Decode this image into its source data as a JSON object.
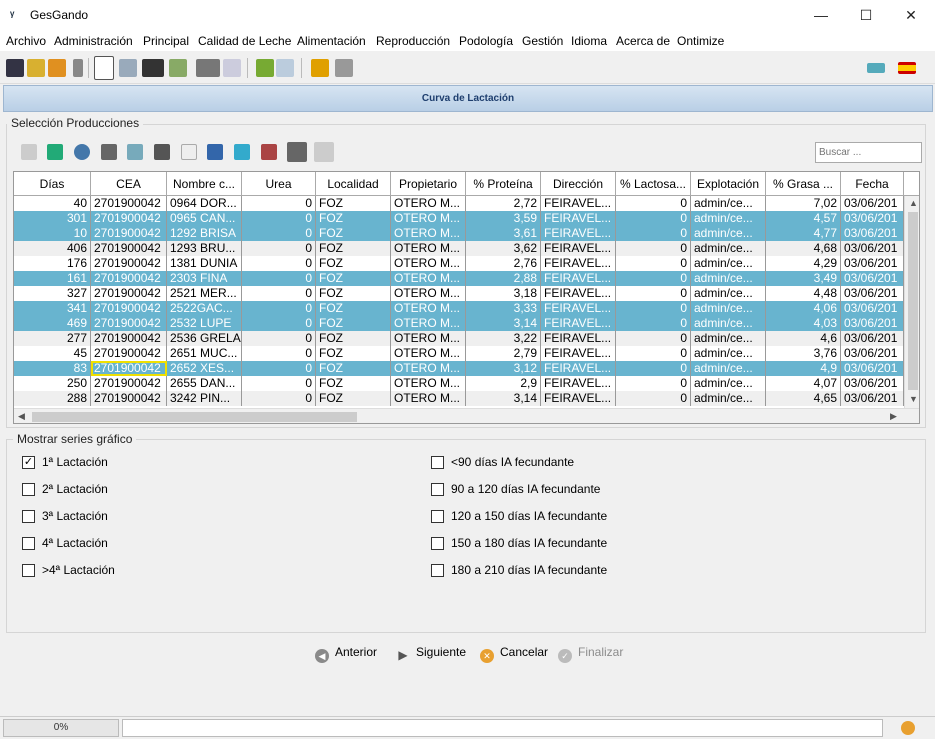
{
  "window": {
    "title": "GesGando",
    "app_icon": "cow-horns-icon",
    "min": "—",
    "max": "☐",
    "close": "✕"
  },
  "menu": [
    "Archivo",
    "Administración",
    "Principal",
    "Calidad de Leche",
    "Alimentación",
    "Reproducción",
    "Podología",
    "Gestión",
    "Idioma",
    "Acerca de",
    "Ontimize"
  ],
  "panel": {
    "title": "Curva de Lactación"
  },
  "selection_group": {
    "label": "Selección Producciones",
    "search_placeholder": "Buscar ..."
  },
  "table": {
    "columns": [
      "Días",
      "CEA",
      "Nombre c...",
      "Urea",
      "Localidad",
      "Propietario",
      "% Proteína",
      "Dirección",
      "% Lactosa...",
      "Explotación",
      "% Grasa ...",
      "Fecha"
    ],
    "rows": [
      {
        "selected": false,
        "cells": [
          "40",
          "2701900042",
          "0964 DOR...",
          "0",
          "FOZ",
          "OTERO M...",
          "2,72",
          "FEIRAVEL...",
          "0",
          "admin/ce...",
          "7,02",
          "03/06/201"
        ]
      },
      {
        "selected": true,
        "cells": [
          "301",
          "2701900042",
          "0965 CAN...",
          "0",
          "FOZ",
          "OTERO M...",
          "3,59",
          "FEIRAVEL...",
          "0",
          "admin/ce...",
          "4,57",
          "03/06/201"
        ]
      },
      {
        "selected": true,
        "cells": [
          "10",
          "2701900042",
          "1292 BRISA",
          "0",
          "FOZ",
          "OTERO M...",
          "3,61",
          "FEIRAVEL...",
          "0",
          "admin/ce...",
          "4,77",
          "03/06/201"
        ]
      },
      {
        "selected": false,
        "cells": [
          "406",
          "2701900042",
          "1293 BRU...",
          "0",
          "FOZ",
          "OTERO M...",
          "3,62",
          "FEIRAVEL...",
          "0",
          "admin/ce...",
          "4,68",
          "03/06/201"
        ]
      },
      {
        "selected": false,
        "cells": [
          "176",
          "2701900042",
          "1381 DUNIA",
          "0",
          "FOZ",
          "OTERO M...",
          "2,76",
          "FEIRAVEL...",
          "0",
          "admin/ce...",
          "4,29",
          "03/06/201"
        ]
      },
      {
        "selected": true,
        "cells": [
          "161",
          "2701900042",
          "2303 FINA",
          "0",
          "FOZ",
          "OTERO M...",
          "2,88",
          "FEIRAVEL...",
          "0",
          "admin/ce...",
          "3,49",
          "03/06/201"
        ]
      },
      {
        "selected": false,
        "cells": [
          "327",
          "2701900042",
          "2521 MER...",
          "0",
          "FOZ",
          "OTERO M...",
          "3,18",
          "FEIRAVEL...",
          "0",
          "admin/ce...",
          "4,48",
          "03/06/201"
        ]
      },
      {
        "selected": true,
        "cells": [
          "341",
          "2701900042",
          "2522GAC...",
          "0",
          "FOZ",
          "OTERO M...",
          "3,33",
          "FEIRAVEL...",
          "0",
          "admin/ce...",
          "4,06",
          "03/06/201"
        ]
      },
      {
        "selected": true,
        "cells": [
          "469",
          "2701900042",
          "2532 LUPE",
          "0",
          "FOZ",
          "OTERO M...",
          "3,14",
          "FEIRAVEL...",
          "0",
          "admin/ce...",
          "4,03",
          "03/06/201"
        ]
      },
      {
        "selected": false,
        "cells": [
          "277",
          "2701900042",
          "2536 GRELA",
          "0",
          "FOZ",
          "OTERO M...",
          "3,22",
          "FEIRAVEL...",
          "0",
          "admin/ce...",
          "4,6",
          "03/06/201"
        ]
      },
      {
        "selected": false,
        "cells": [
          "45",
          "2701900042",
          "2651 MUC...",
          "0",
          "FOZ",
          "OTERO M...",
          "2,79",
          "FEIRAVEL...",
          "0",
          "admin/ce...",
          "3,76",
          "03/06/201"
        ]
      },
      {
        "selected": true,
        "cells": [
          "83",
          "2701900042",
          "2652 XES...",
          "0",
          "FOZ",
          "OTERO M...",
          "3,12",
          "FEIRAVEL...",
          "0",
          "admin/ce...",
          "4,9",
          "03/06/201"
        ]
      },
      {
        "selected": false,
        "cells": [
          "250",
          "2701900042",
          "2655 DAN...",
          "0",
          "FOZ",
          "OTERO M...",
          "2,9",
          "FEIRAVEL...",
          "0",
          "admin/ce...",
          "4,07",
          "03/06/201"
        ]
      },
      {
        "selected": false,
        "cells": [
          "288",
          "2701900042",
          "3242 PIN...",
          "0",
          "FOZ",
          "OTERO M...",
          "3,14",
          "FEIRAVEL...",
          "0",
          "admin/ce...",
          "4,65",
          "03/06/201"
        ]
      }
    ],
    "focused_cell": {
      "row": 11,
      "col": 1
    }
  },
  "series_group": {
    "label": "Mostrar series gráfico",
    "left": [
      {
        "label": "1ª Lactación",
        "checked": true
      },
      {
        "label": "2ª Lactación",
        "checked": false
      },
      {
        "label": "3ª Lactación",
        "checked": false
      },
      {
        "label": "4ª Lactación",
        "checked": false
      },
      {
        "label": ">4ª Lactación",
        "checked": false
      }
    ],
    "right": [
      {
        "label": "<90 días IA fecundante",
        "checked": false
      },
      {
        "label": "90 a 120 días IA fecundante",
        "checked": false
      },
      {
        "label": "120 a 150 días IA fecundante",
        "checked": false
      },
      {
        "label": "150 a 180 días IA fecundante",
        "checked": false
      },
      {
        "label": "180 a 210 días IA fecundante",
        "checked": false
      }
    ]
  },
  "nav": {
    "prev": "Anterior",
    "next": "Siguiente",
    "cancel": "Cancelar",
    "finish": "Finalizar"
  },
  "status": {
    "progress": "0%"
  },
  "colors": {
    "selected_row": "#68b4cf",
    "header_gradient": "#b9cfe6",
    "focus_border": "#f0e000"
  }
}
